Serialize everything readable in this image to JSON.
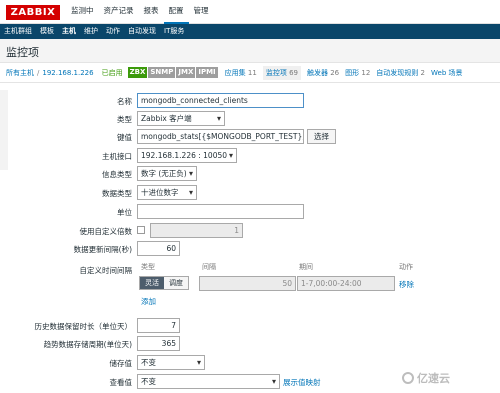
{
  "topbar": {
    "logo": "ZABBIX",
    "nav": [
      "监测中",
      "资产记录",
      "报表",
      "配置",
      "管理"
    ],
    "active_index": 3
  },
  "subbar": {
    "items": [
      "主机群组",
      "模板",
      "主机",
      "维护",
      "动作",
      "自动发现",
      "IT服务"
    ],
    "active_index": 2
  },
  "page": {
    "title": "监控项"
  },
  "hostbar": {
    "all_hosts": "所有主机",
    "separator": "/",
    "host_ip": "192.168.1.226",
    "enabled": "已启用",
    "availability": [
      "ZBX",
      "SNMP",
      "JMX",
      "IPMI"
    ],
    "tabs": [
      {
        "label": "应用集",
        "count": "11"
      },
      {
        "label": "监控项",
        "count": "69"
      },
      {
        "label": "触发器",
        "count": "26"
      },
      {
        "label": "图形",
        "count": "12"
      },
      {
        "label": "自动发现规则",
        "count": "2"
      },
      {
        "label": "Web 场景",
        "count": ""
      }
    ]
  },
  "form": {
    "name_label": "名称",
    "name_value": "mongodb_connected_clients",
    "type_label": "类型",
    "type_value": "Zabbix 客户端",
    "key_label": "键值",
    "key_value": "mongodb_stats[{$MONGODB_PORT_TEST},con",
    "key_select_button": "选择",
    "interface_label": "主机接口",
    "interface_value": "192.168.1.226 : 10050",
    "info_type_label": "信息类型",
    "info_type_value": "数字 (无正负)",
    "data_type_label": "数据类型",
    "data_type_value": "十进位数字",
    "units_label": "单位",
    "units_value": "",
    "multiplier_label": "使用自定义倍数",
    "multiplier_value": "1",
    "update_interval_label": "数据更新间隔(秒)",
    "update_interval_value": "60",
    "custom_intervals_label": "自定义时间间隔",
    "custom_intervals": {
      "col_type": "类型",
      "col_interval": "间隔",
      "col_period": "期间",
      "col_action": "动作",
      "toggle_flexible": "灵活",
      "toggle_scheduling": "调度",
      "interval_value": "50",
      "period_value": "1-7,00:00-24:00",
      "remove_link": "移除",
      "add_link": "添加"
    },
    "history_label": "历史数据保留时长（单位天）",
    "history_value": "7",
    "trends_label": "趋势数据存储周期(单位天)",
    "trends_value": "365",
    "store_value_label": "储存值",
    "store_value_value": "不变",
    "show_value_label": "查看值",
    "show_value_value": "不变",
    "show_value_mapping_link": "展示值映射"
  },
  "watermark": {
    "text": "亿速云"
  }
}
